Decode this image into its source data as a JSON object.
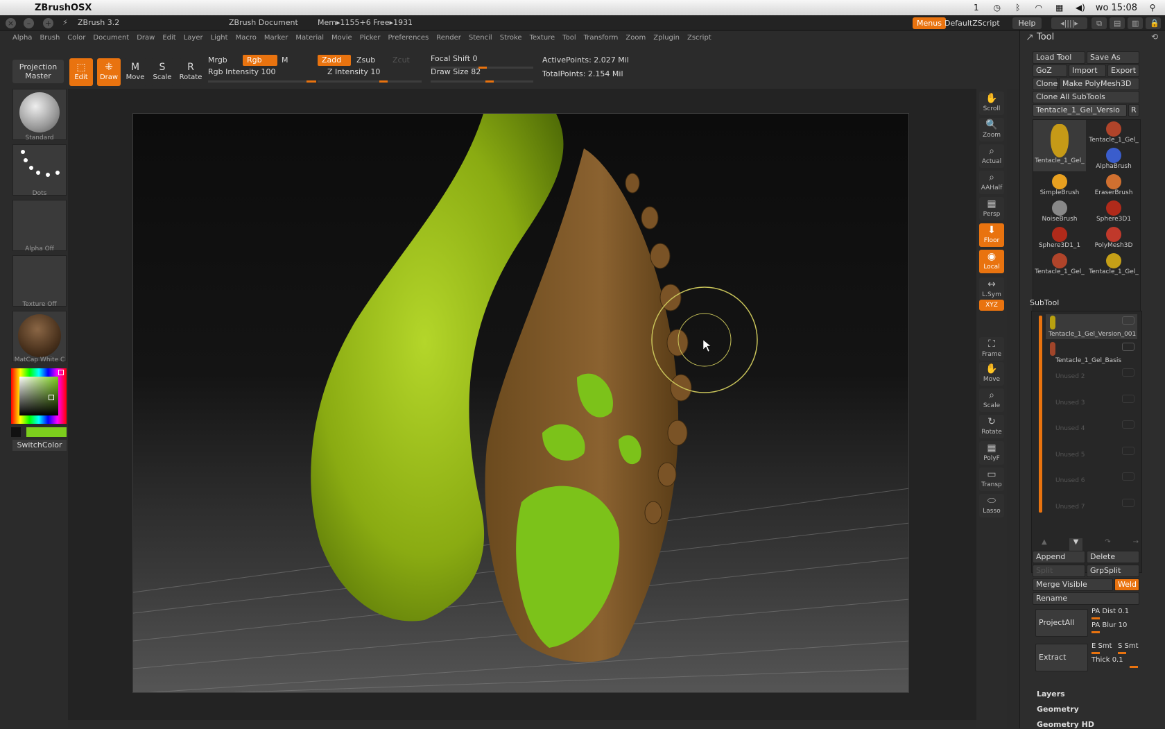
{
  "macbar": {
    "app_name": "ZBrushOSX",
    "clock": "wo 15:08"
  },
  "titlebar": {
    "app_version": "ZBrush 3.2",
    "document": "ZBrush Document",
    "mem": "Mem▸1155+6 Free▸1931",
    "menus_btn": "Menus",
    "script_btn": "DefaultZScript",
    "help_btn": "Help"
  },
  "menu": [
    "Alpha",
    "Brush",
    "Color",
    "Document",
    "Draw",
    "Edit",
    "Layer",
    "Light",
    "Macro",
    "Marker",
    "Material",
    "Movie",
    "Picker",
    "Preferences",
    "Render",
    "Stencil",
    "Stroke",
    "Texture",
    "Tool",
    "Transform",
    "Zoom",
    "Zplugin",
    "Zscript"
  ],
  "shelf": {
    "projection_master": "Projection Master",
    "edit": "Edit",
    "draw": "Draw",
    "move": "Move",
    "scale": "Scale",
    "rotate": "Rotate",
    "mrgb": "Mrgb",
    "rgb": "Rgb",
    "m": "M",
    "rgb_intensity": "Rgb Intensity 100",
    "zadd": "Zadd",
    "zsub": "Zsub",
    "zcut": "Zcut",
    "z_intensity": "Z Intensity 10",
    "focal_shift": "Focal Shift 0",
    "draw_size": "Draw Size 82",
    "active_points": "ActivePoints: 2.027 Mil",
    "total_points": "TotalPoints: 2.154 Mil"
  },
  "lefttray": {
    "standard": "Standard",
    "dots": "Dots",
    "alpha_off": "Alpha Off",
    "texture_off": "Texture Off",
    "matcap": "MatCap White C",
    "switch_color": "SwitchColor"
  },
  "rtools": [
    "Scroll",
    "Zoom",
    "Actual",
    "AAHalf",
    "Persp",
    "Floor",
    "Local",
    "L.Sym",
    "XYZ",
    "Frame",
    "Move",
    "Scale",
    "Rotate",
    "PolyF",
    "Transp",
    "Lasso"
  ],
  "tool_panel": {
    "title": "Tool",
    "load_tool": "Load Tool",
    "save_as": "Save As",
    "goz": "GoZ",
    "import": "Import",
    "export": "Export",
    "clone": "Clone",
    "make_polymesh": "Make PolyMesh3D",
    "clone_all": "Clone All SubTools",
    "current_tool": "Tentacle_1_Gel_Versio",
    "r": "R",
    "tools": [
      {
        "label": "Tentacle_1_Gel_",
        "color": "#c69a17"
      },
      {
        "label": "Tentacle_1_Gel_",
        "color": "#b0442a"
      },
      {
        "label": "AlphaBrush",
        "color": "#3a5dcc"
      },
      {
        "label": "SimpleBrush",
        "color": "#e8a020"
      },
      {
        "label": "EraserBrush",
        "color": "#d07030"
      },
      {
        "label": "NoiseBrush",
        "color": "#888888"
      },
      {
        "label": "Sphere3D1",
        "color": "#b02a1a"
      },
      {
        "label": "Sphere3D1_1",
        "color": "#b02a1a"
      },
      {
        "label": "PolyMesh3D",
        "color": "#c0392b"
      },
      {
        "label": "Tentacle_1_Gel_",
        "color": "#b0442a"
      },
      {
        "label": "Tentacle_1_Gel_",
        "color": "#c6a017"
      }
    ]
  },
  "subtool": {
    "title": "SubTool",
    "rows": [
      "Tentacle_1_Gel_Version_001",
      "Tentacle_1_Gel_Basis",
      "Unused 2",
      "Unused 3",
      "Unused 4",
      "Unused 5",
      "Unused 6",
      "Unused 7"
    ],
    "append": "Append",
    "delete": "Delete",
    "split": "Split",
    "grpsplit": "GrpSplit",
    "merge_visible": "Merge Visible",
    "weld": "Weld",
    "rename": "Rename",
    "project_all": "ProjectAll",
    "pa_dist": "PA Dist 0.1",
    "pa_blur": "PA Blur 10",
    "extract": "Extract",
    "e_smt": "E Smt",
    "s_smt": "S Smt",
    "thick": "Thick 0.1"
  },
  "sections": [
    "Layers",
    "Geometry",
    "Geometry HD"
  ]
}
